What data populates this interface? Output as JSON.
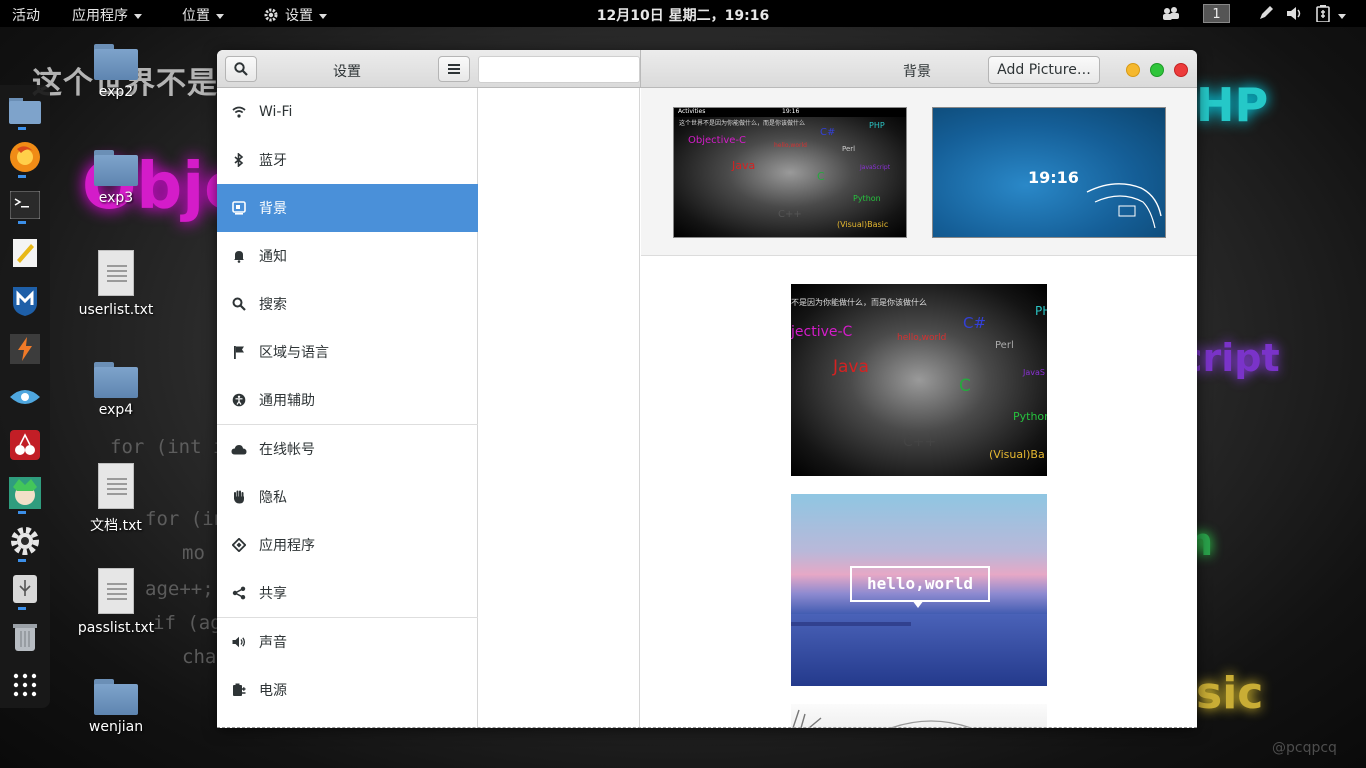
{
  "topbar": {
    "activities": "活动",
    "applications": "应用程序",
    "places": "位置",
    "settings": "设置",
    "clock": "12月10日 星期二，19:16",
    "workspace": "1"
  },
  "wallpaper": {
    "title": "这个世界不是",
    "objc": "Obje",
    "php": "HP",
    "script": "cript",
    "n": "n",
    "basic": "sic",
    "code1": "for (int i = 0;",
    "code2": "for (int j",
    "code3": "mo",
    "code4": "age++;",
    "code5": "if (age",
    "code6": "cha",
    "signature": "@pcqpcq"
  },
  "desktop": {
    "icons": [
      {
        "label": "exp2",
        "type": "folder"
      },
      {
        "label": "exp3",
        "type": "folder"
      },
      {
        "label": "userlist.txt",
        "type": "file"
      },
      {
        "label": "exp4",
        "type": "folder"
      },
      {
        "label": "文档.txt",
        "type": "file"
      },
      {
        "label": "passlist.txt",
        "type": "file"
      },
      {
        "label": "wenjian",
        "type": "folder"
      }
    ]
  },
  "dock": {
    "items": [
      "files-icon",
      "firefox-icon",
      "terminal-icon",
      "text-editor-icon",
      "metasploit-icon",
      "burpsuite-icon",
      "eye-icon",
      "cherrytree-icon",
      "avatar-app-icon",
      "settings-icon",
      "usb-icon",
      "trash-icon",
      "show-apps-icon"
    ]
  },
  "window": {
    "sidebar_title": "设置",
    "panel_title": "背景",
    "add_picture": "Add Picture…",
    "sidebar": [
      {
        "label": "Wi-Fi",
        "icon": "wifi-icon"
      },
      {
        "label": "蓝牙",
        "icon": "bluetooth-icon"
      },
      {
        "label": "背景",
        "icon": "background-icon",
        "active": true
      },
      {
        "label": "通知",
        "icon": "bell-icon"
      },
      {
        "label": "搜索",
        "icon": "search-icon"
      },
      {
        "label": "区域与语言",
        "icon": "flag-icon"
      },
      {
        "label": "通用辅助",
        "icon": "accessibility-icon"
      },
      {
        "label": "在线帐号",
        "icon": "cloud-icon"
      },
      {
        "label": "隐私",
        "icon": "hand-icon"
      },
      {
        "label": "应用程序",
        "icon": "apps-icon"
      },
      {
        "label": "共享",
        "icon": "share-icon"
      },
      {
        "label": "声音",
        "icon": "speaker-icon"
      },
      {
        "label": "电源",
        "icon": "power-icon"
      }
    ],
    "lock_preview": {
      "time": "19:16"
    },
    "desktop_preview": {
      "activities": "Activities",
      "time": "19:16",
      "headline": "这个世界不是因为你能做什么，而是你该做什么"
    },
    "wallpaper_words": {
      "objc": "Objective-C",
      "csharp": "C#",
      "php": "PHP",
      "hello": "hello,world",
      "perl": "Perl",
      "java": "Java",
      "js": "JavaScript",
      "c": "C",
      "python": "Python",
      "cpp": "C++",
      "vb": "(Visual)Basic"
    },
    "gallery_1": {
      "headline": "不是因为你能做什么，而是你该做什么",
      "objc": "jective-C",
      "csharp": "C#",
      "php": "PH",
      "hello": "hello,world",
      "perl": "Perl",
      "java": "Java",
      "js": "JavaS",
      "c": "C",
      "python": "Python",
      "cpp": "C++",
      "vb": "(Visual)Ba"
    },
    "gallery_2": {
      "bubble": "hello,world"
    }
  }
}
